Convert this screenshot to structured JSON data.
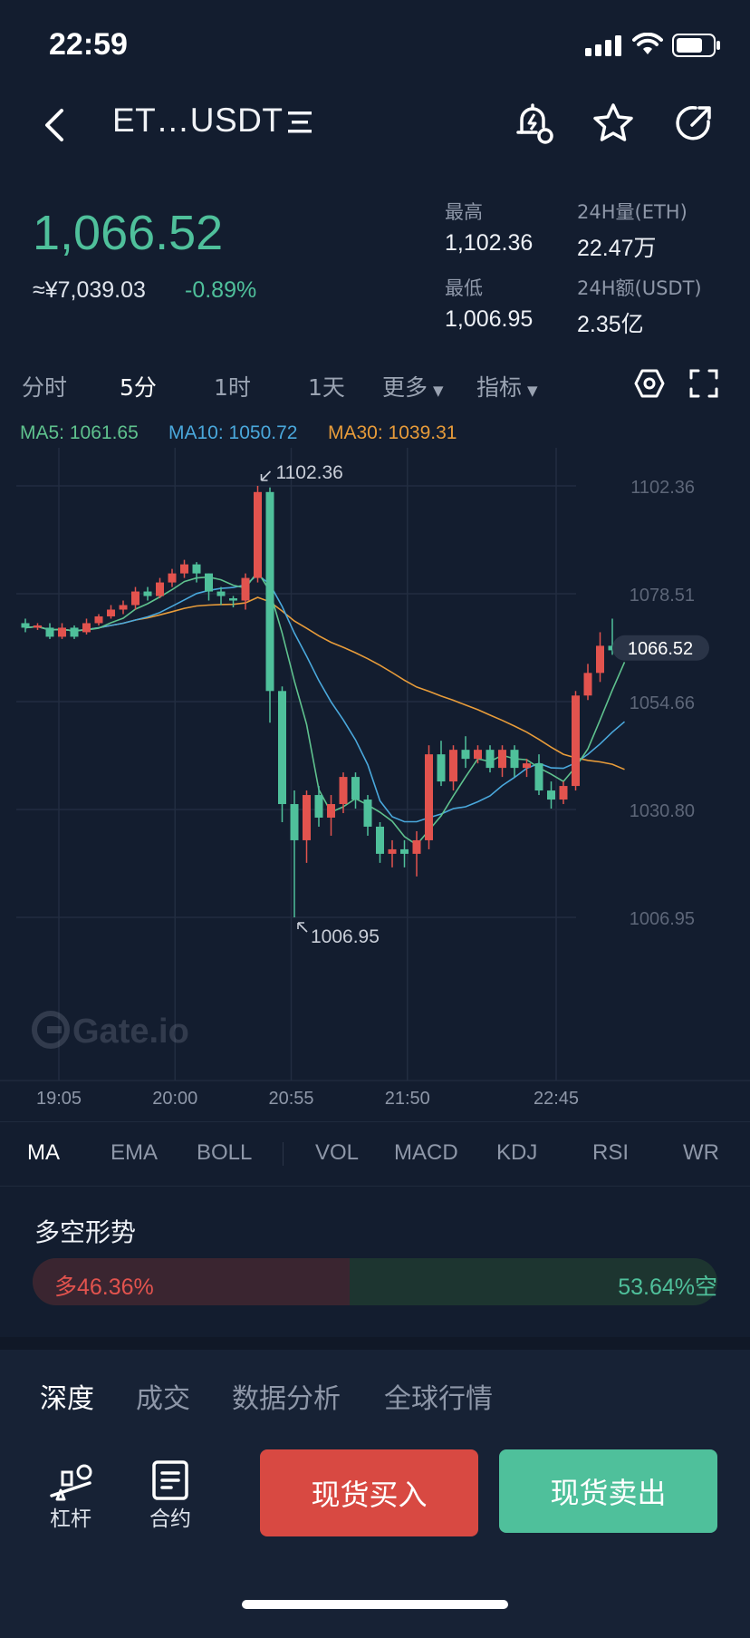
{
  "status_bar": {
    "time": "22:59"
  },
  "header": {
    "pair": "ET…USDT",
    "back_icon": "back-arrow-icon",
    "menu_icon": "pair-list-icon",
    "alert_icon": "price-alert-icon",
    "favorite_icon": "star-icon",
    "share_icon": "share-icon"
  },
  "ticker": {
    "price": "1,066.52",
    "cny": "≈¥7,039.03",
    "change": "-0.89%",
    "high_label": "最高",
    "high": "1,102.36",
    "low_label": "最低",
    "low": "1,006.95",
    "vol_label": "24H量(ETH)",
    "vol": "22.47万",
    "amount_label": "24H额(USDT)",
    "amount": "2.35亿"
  },
  "timeframes": {
    "t1": "分时",
    "t2": "5分",
    "t3": "1时",
    "t4": "1天",
    "more": "更多",
    "indicator": "指标",
    "active": "5分"
  },
  "ma_legend": {
    "ma5": "MA5: 1061.65",
    "ma10": "MA10: 1050.72",
    "ma30": "MA30: 1039.31"
  },
  "colors": {
    "up": "#e2534e",
    "down": "#4fc09b",
    "ma5": "#5fc28e",
    "ma10": "#4aa8dc",
    "ma30": "#e89c3a",
    "background": "#131d2f"
  },
  "chart_data": {
    "type": "candlestick",
    "x_ticks": [
      "19:05",
      "20:00",
      "20:55",
      "21:50",
      "22:45"
    ],
    "y_ticks": [
      "1102.36",
      "1078.51",
      "1054.66",
      "1030.80",
      "1006.95"
    ],
    "ylim": [
      1006.95,
      1102.36
    ],
    "high_marker": "1102.36",
    "low_marker": "1006.95",
    "last_price": "1066.52",
    "candles": [
      [
        1072,
        1071,
        1073,
        1070
      ],
      [
        1071,
        1071.5,
        1072,
        1070.5
      ],
      [
        1071,
        1069,
        1072,
        1068.5
      ],
      [
        1069,
        1071,
        1072,
        1068.5
      ],
      [
        1071,
        1069,
        1071.5,
        1068.5
      ],
      [
        1070,
        1072,
        1073,
        1069.5
      ],
      [
        1072,
        1073.5,
        1074,
        1071.5
      ],
      [
        1073.5,
        1075,
        1076,
        1073
      ],
      [
        1075,
        1076,
        1077,
        1074
      ],
      [
        1076,
        1079,
        1080,
        1075
      ],
      [
        1079,
        1078,
        1080,
        1077
      ],
      [
        1078,
        1081,
        1082,
        1077.5
      ],
      [
        1081,
        1083,
        1084,
        1080
      ],
      [
        1083,
        1085,
        1086,
        1082
      ],
      [
        1085,
        1083,
        1085.5,
        1081
      ],
      [
        1083,
        1079,
        1083,
        1077
      ],
      [
        1079,
        1078,
        1080,
        1076
      ],
      [
        1077.5,
        1077,
        1078,
        1075.5
      ],
      [
        1077,
        1082,
        1083,
        1075
      ],
      [
        1082,
        1101,
        1102.36,
        1081
      ],
      [
        1101,
        1057,
        1102,
        1050
      ],
      [
        1057,
        1032,
        1058,
        1028
      ],
      [
        1032,
        1024,
        1035,
        1006.95
      ],
      [
        1024,
        1034,
        1035,
        1019
      ],
      [
        1034,
        1029,
        1036,
        1027
      ],
      [
        1029,
        1032,
        1034,
        1025
      ],
      [
        1032,
        1038,
        1039,
        1030
      ],
      [
        1038,
        1033,
        1039,
        1031
      ],
      [
        1033,
        1027,
        1034,
        1025
      ],
      [
        1027,
        1021,
        1028,
        1019
      ],
      [
        1021,
        1022,
        1024,
        1018
      ],
      [
        1022,
        1021,
        1024,
        1018
      ],
      [
        1021,
        1024,
        1026,
        1016
      ],
      [
        1024,
        1043,
        1045,
        1022
      ],
      [
        1043,
        1037,
        1046,
        1036
      ],
      [
        1037,
        1044,
        1045,
        1035
      ],
      [
        1044,
        1042,
        1047,
        1040
      ],
      [
        1042,
        1044,
        1045,
        1041
      ],
      [
        1044,
        1040,
        1045,
        1039
      ],
      [
        1040,
        1044,
        1045,
        1038
      ],
      [
        1044,
        1040,
        1045,
        1038
      ],
      [
        1040,
        1041,
        1042,
        1038
      ],
      [
        1041,
        1035,
        1043,
        1034
      ],
      [
        1035,
        1033,
        1037,
        1031
      ],
      [
        1033,
        1036,
        1037,
        1032
      ],
      [
        1036,
        1056,
        1057,
        1035
      ],
      [
        1056,
        1061,
        1063,
        1055
      ],
      [
        1061,
        1067,
        1070,
        1059
      ],
      [
        1067,
        1066,
        1073,
        1065
      ],
      [
        1066,
        1067,
        1069,
        1065
      ]
    ]
  },
  "indicator_tabs": {
    "ma": "MA",
    "ema": "EMA",
    "boll": "BOLL",
    "vol": "VOL",
    "macd": "MACD",
    "kdj": "KDJ",
    "rsi": "RSI",
    "wr": "WR",
    "active": "MA"
  },
  "long_short": {
    "title": "多空形势",
    "long": "多46.36%",
    "short": "53.64%空",
    "long_pct": 46.36
  },
  "bottom_tabs": {
    "depth": "深度",
    "trades": "成交",
    "analysis": "数据分析",
    "global": "全球行情"
  },
  "actions": {
    "leverage": "杠杆",
    "contract": "合约",
    "buy": "现货买入",
    "sell": "现货卖出"
  },
  "watermark": "Gate.io"
}
